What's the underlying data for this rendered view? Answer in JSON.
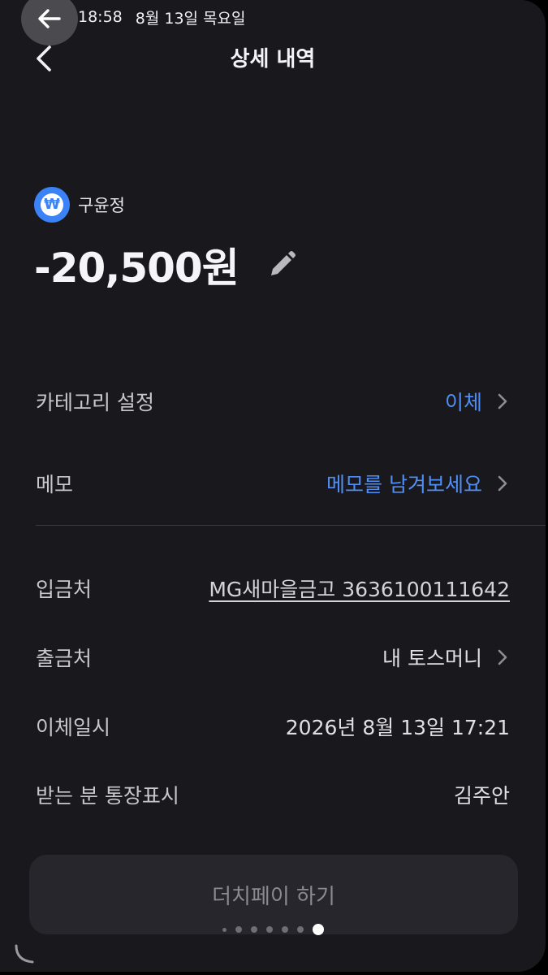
{
  "status_bar": {
    "time": "18:58",
    "date": "8월 13일 목요일"
  },
  "header": {
    "title": "상세 내역"
  },
  "account": {
    "name": "구윤정",
    "icon": "won-icon",
    "badge_symbol": "₩",
    "badge_color": "#3b82f6"
  },
  "transaction": {
    "amount": "-20,500원"
  },
  "rows": {
    "category": {
      "label": "카테고리 설정",
      "value": "이체"
    },
    "memo": {
      "label": "메모",
      "value": "메모를 남겨보세요"
    },
    "deposit_to": {
      "label": "입금처",
      "value": "MG새마을금고 3636100111642"
    },
    "withdraw_from": {
      "label": "출금처",
      "value": "내 토스머니"
    },
    "transfer_datetime": {
      "label": "이체일시",
      "value": "2026년 8월 13일 17:21"
    },
    "recipient_display": {
      "label": "받는 분 통장표시",
      "value": "김주안"
    }
  },
  "actions": {
    "dutch_pay": "더치페이 하기"
  },
  "colors": {
    "accent": "#4f8ff7",
    "background": "#18181d"
  }
}
